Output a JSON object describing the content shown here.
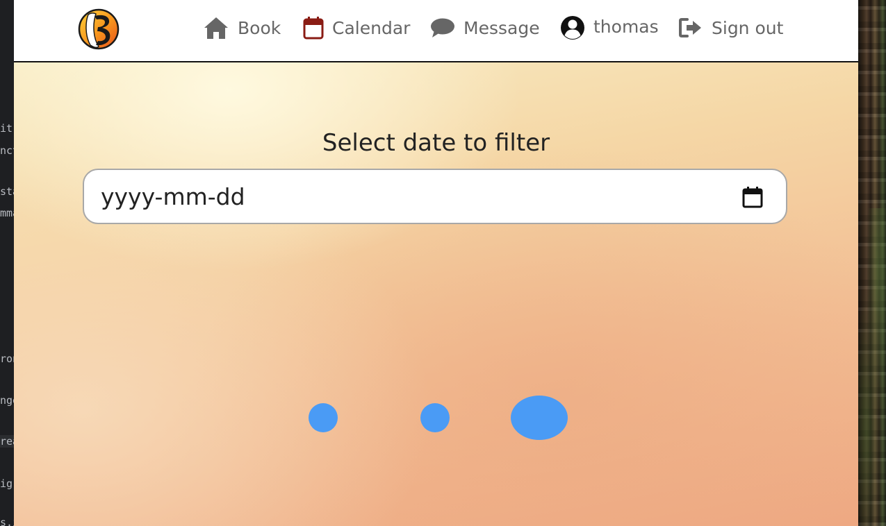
{
  "editor_fragments": [
    "it",
    "nct",
    "sta",
    "mma",
    "ron",
    "nge",
    "rea",
    "igr",
    "s.i"
  ],
  "nav": {
    "book": {
      "label": "Book",
      "icon": "home-icon"
    },
    "calendar": {
      "label": "Calendar",
      "icon": "calendar-icon"
    },
    "message": {
      "label": "Message",
      "icon": "chat-bubble-icon"
    },
    "profile": {
      "label": "thomas",
      "icon": "user-circle-icon"
    },
    "signout": {
      "label": "Sign out",
      "icon": "sign-out-icon"
    }
  },
  "filter": {
    "title": "Select date to filter",
    "placeholder": "yyyy-mm-dd",
    "value": ""
  },
  "colors": {
    "nav_text": "#666666",
    "calendar_icon": "#8a1c14",
    "loader_dot": "#4a9bf5",
    "navbar_border": "#111111"
  },
  "loading_indicator": {
    "dots": 3
  }
}
